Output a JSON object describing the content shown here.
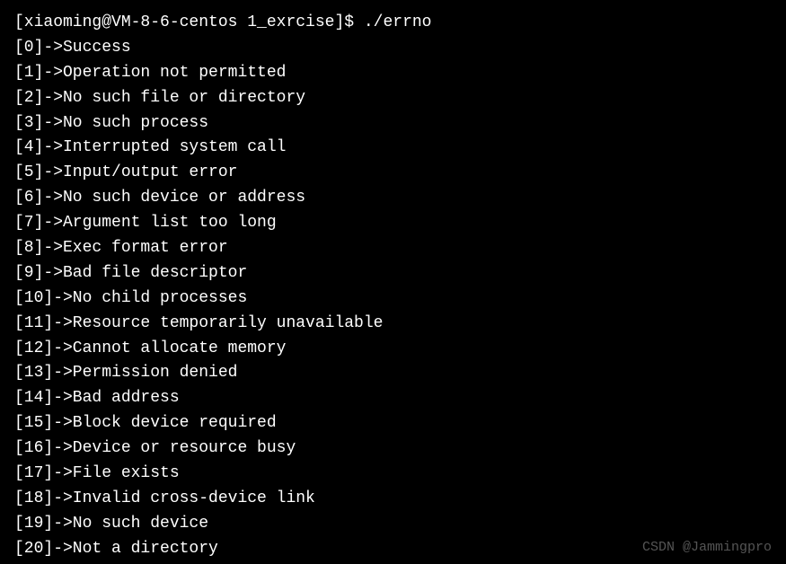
{
  "terminal": {
    "prompt": "[xiaoming@VM-8-6-centos 1_exrcise]$ ./errno",
    "lines": [
      "[0]->Success",
      "[1]->Operation not permitted",
      "[2]->No such file or directory",
      "[3]->No such process",
      "[4]->Interrupted system call",
      "[5]->Input/output error",
      "[6]->No such device or address",
      "[7]->Argument list too long",
      "[8]->Exec format error",
      "[9]->Bad file descriptor",
      "[10]->No child processes",
      "[11]->Resource temporarily unavailable",
      "[12]->Cannot allocate memory",
      "[13]->Permission denied",
      "[14]->Bad address",
      "[15]->Block device required",
      "[16]->Device or resource busy",
      "[17]->File exists",
      "[18]->Invalid cross-device link",
      "[19]->No such device",
      "[20]->Not a directory"
    ]
  },
  "watermark": {
    "text": "CSDN @Jammingpro"
  }
}
